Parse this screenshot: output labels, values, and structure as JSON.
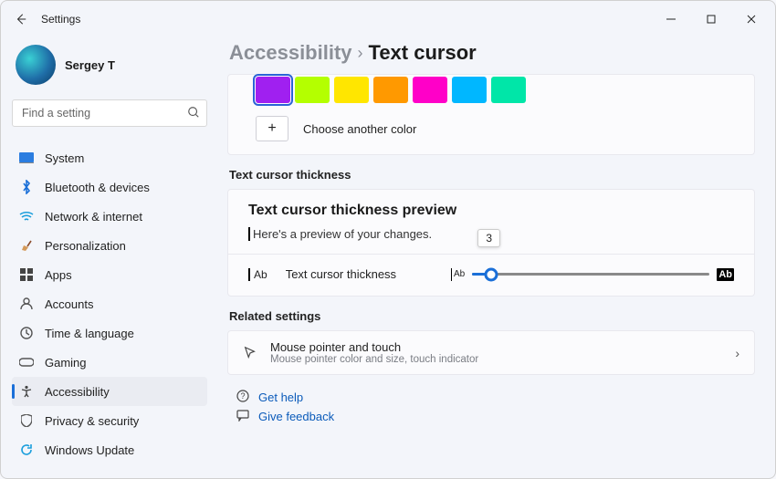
{
  "titlebar": {
    "title": "Settings"
  },
  "user": {
    "name": "Sergey T"
  },
  "search": {
    "placeholder": "Find a setting"
  },
  "nav": {
    "system": "System",
    "bluetooth": "Bluetooth & devices",
    "network": "Network & internet",
    "personalization": "Personalization",
    "apps": "Apps",
    "accounts": "Accounts",
    "time": "Time & language",
    "gaming": "Gaming",
    "accessibility": "Accessibility",
    "privacy": "Privacy & security",
    "update": "Windows Update"
  },
  "breadcrumb": {
    "parent": "Accessibility",
    "sep": "›",
    "current": "Text cursor"
  },
  "colors": {
    "items": [
      "#a020f0",
      "#b4ff00",
      "#ffe600",
      "#ff9900",
      "#ff00c8",
      "#00b7ff",
      "#00e6a8"
    ],
    "selected_index": 0,
    "choose_label": "Choose another color"
  },
  "thickness": {
    "section_label": "Text cursor thickness",
    "preview_title": "Text cursor thickness preview",
    "preview_text": "Here's a preview of your changes.",
    "slider_label": "Text cursor thickness",
    "value": "3",
    "min_glyph": "Ab",
    "max_glyph": "Ab"
  },
  "related": {
    "section_label": "Related settings",
    "mouse_title": "Mouse pointer and touch",
    "mouse_sub": "Mouse pointer color and size, touch indicator"
  },
  "help": {
    "get_help": "Get help",
    "feedback": "Give feedback"
  }
}
